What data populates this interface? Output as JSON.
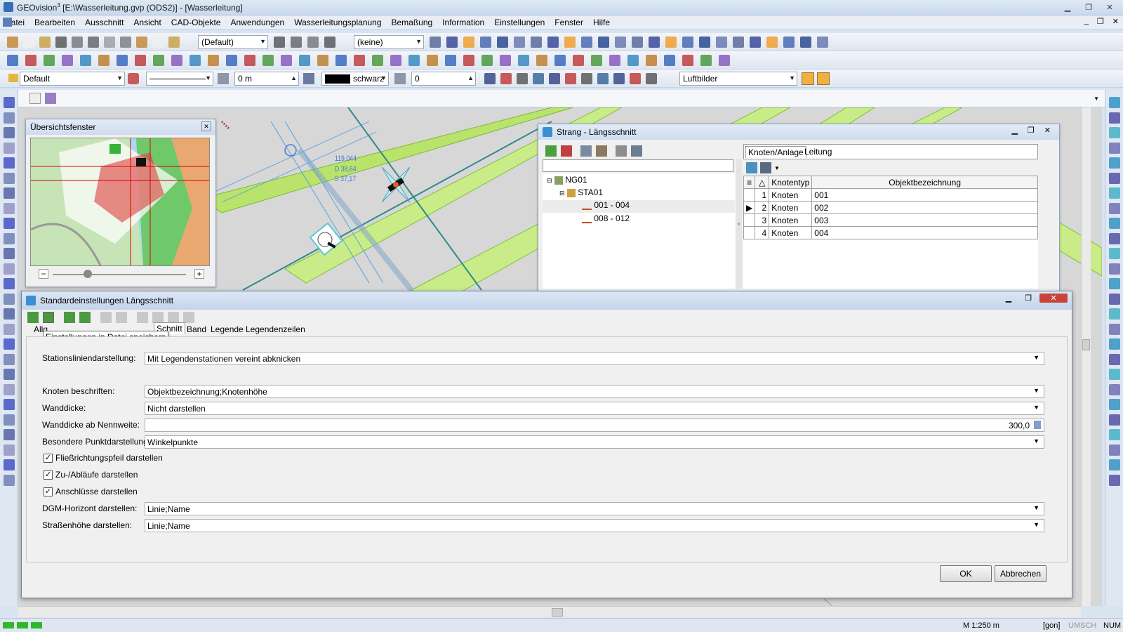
{
  "window": {
    "title_prefix": "GEOvision",
    "title_sup": "3",
    "title_rest": " [E:\\Wasserleitung.gvp (ODS2)] - [Wasserleitung]"
  },
  "menu": [
    "Datei",
    "Bearbeiten",
    "Ausschnitt",
    "Ansicht",
    "CAD-Objekte",
    "Anwendungen",
    "Wasserleitungsplanung",
    "Bemaßung",
    "Information",
    "Einstellungen",
    "Fenster",
    "Hilfe"
  ],
  "toolbar1": {
    "style_combo": "(Default)",
    "layer_combo": "(keine)"
  },
  "toolbar3": {
    "layer": "Default",
    "offset": "0 m",
    "color_name": "schwarz",
    "value": "0",
    "background": "Luftbilder"
  },
  "overview": {
    "title": "Übersichtsfenster",
    "minus": "−",
    "plus": "+"
  },
  "map_labels": {
    "label1": "119,044",
    "label2": "D 38,64",
    "label3": "S 37,17"
  },
  "strang": {
    "title": "Strang - Längsschnitt",
    "tree": [
      {
        "label": "NG01"
      },
      {
        "label": "STA01"
      },
      {
        "label": "001 - 004"
      },
      {
        "label": "008 - 012"
      }
    ],
    "tabs": [
      "Knoten/Anlage",
      "Leitung"
    ],
    "headers": [
      "Knotentyp",
      "Objektbezeichnung"
    ],
    "rows": [
      {
        "num": "1",
        "typ": "Knoten",
        "bez": "001"
      },
      {
        "num": "2",
        "typ": "Knoten",
        "bez": "002"
      },
      {
        "num": "3",
        "typ": "Knoten",
        "bez": "003"
      },
      {
        "num": "4",
        "typ": "Knoten",
        "bez": "004"
      }
    ]
  },
  "dialog": {
    "title": "Standardeinstellungen Längsschnitt",
    "tooltip": "Einstellungen in Datei speichern",
    "tabs": [
      "Allg",
      "Schnitt",
      "Band",
      "Legende",
      "Legendenzeilen"
    ],
    "fields": {
      "stationslinien_label": "Stationsliniendarstellung:",
      "stationslinien_value": "Mit Legendenstationen vereint abknicken",
      "knoten_label": "Knoten beschriften:",
      "knoten_value": "Objektbezeichnung;Knotenhöhe",
      "wanddicke_label": "Wanddicke:",
      "wanddicke_value": "Nicht darstellen",
      "wanddicke_nw_label": "Wanddicke ab Nennweite:",
      "wanddicke_nw_value": "300,0",
      "punkt_label": "Besondere Punktdarstellung:",
      "punkt_value": "Winkelpunkte",
      "dgm_label": "DGM-Horizont darstellen:",
      "dgm_value": "Linie;Name",
      "strasse_label": "Straßenhöhe darstellen:",
      "strasse_value": "Linie;Name"
    },
    "checks": [
      {
        "label": "Fließrichtungspfeil darstellen",
        "checked": true
      },
      {
        "label": "Zu-/Abläufe darstellen",
        "checked": true
      },
      {
        "label": "Anschlüsse darstellen",
        "checked": true
      }
    ],
    "ok": "OK",
    "cancel": "Abbrechen"
  },
  "statusbar": {
    "scale": "M 1:250  m",
    "unit": "[gon]",
    "caps": "UMSCH",
    "num": "NUM"
  }
}
